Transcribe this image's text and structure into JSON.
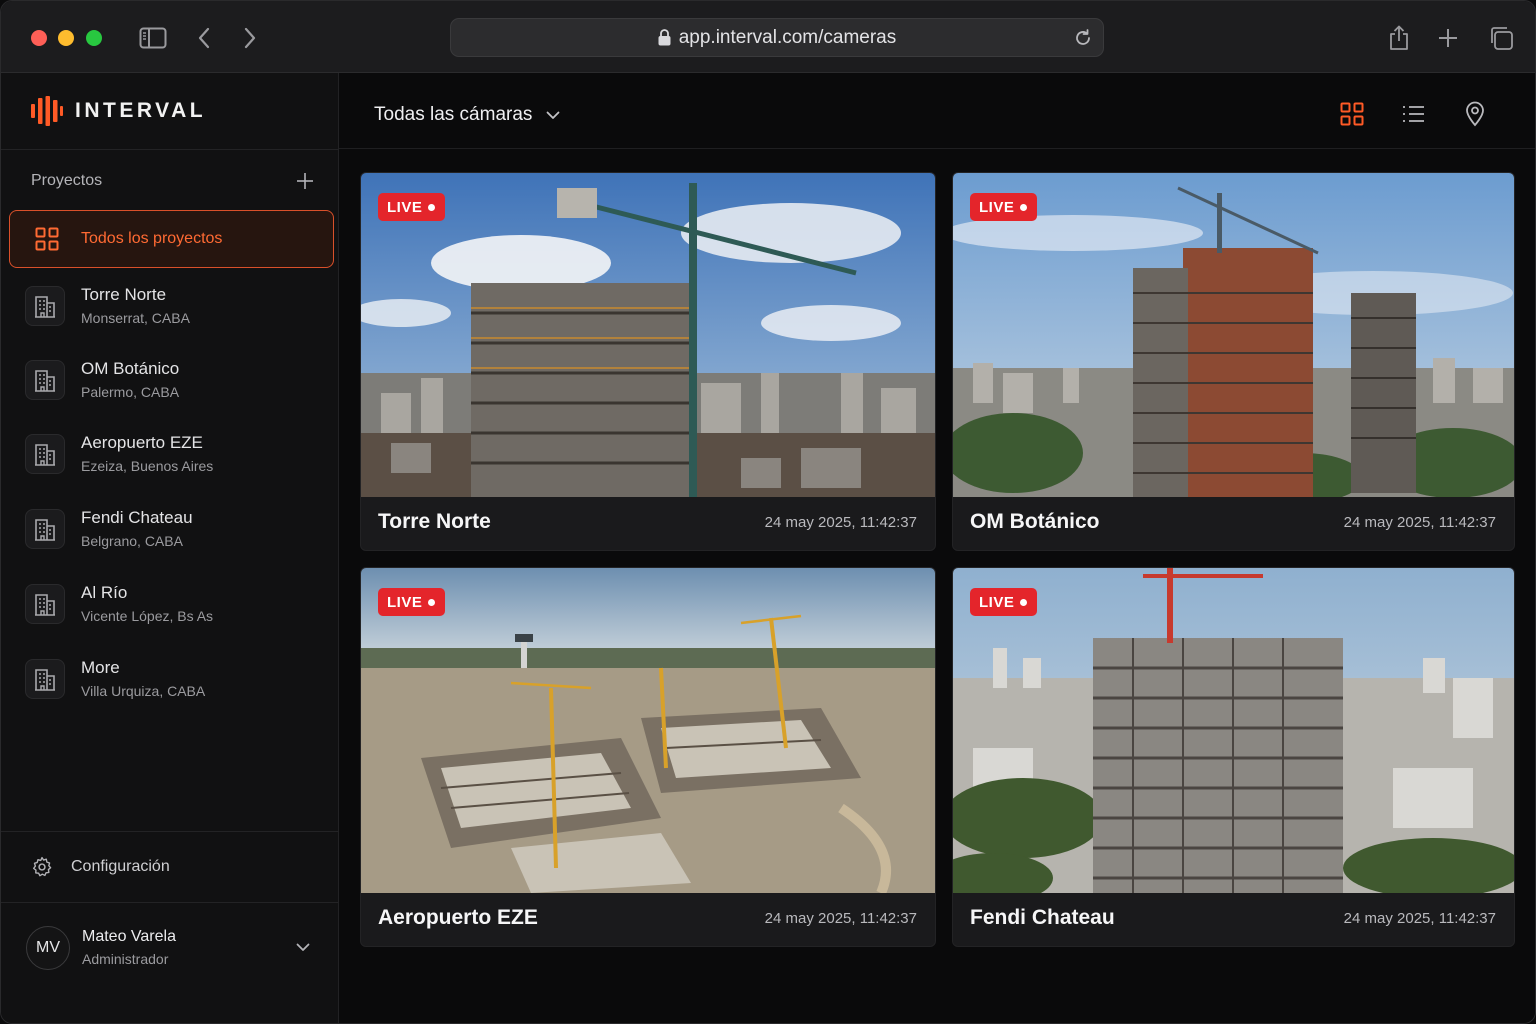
{
  "browser": {
    "url": "app.interval.com/cameras"
  },
  "brand": {
    "name": "INTERVAL",
    "accent": "#ff5a26"
  },
  "sidebar": {
    "projects_title": "Proyectos",
    "all_projects": "Todos los proyectos",
    "projects": [
      {
        "name": "Torre Norte",
        "location": "Monserrat, CABA"
      },
      {
        "name": "OM Botánico",
        "location": "Palermo, CABA"
      },
      {
        "name": "Aeropuerto EZE",
        "location": "Ezeiza, Buenos Aires"
      },
      {
        "name": "Fendi Chateau",
        "location": "Belgrano, CABA"
      },
      {
        "name": "Al Río",
        "location": "Vicente López, Bs As"
      },
      {
        "name": "More",
        "location": "Villa Urquiza, CABA"
      }
    ],
    "settings": "Configuración",
    "user": {
      "initials": "MV",
      "name": "Mateo Varela",
      "role": "Administrador"
    }
  },
  "main": {
    "filter": "Todas las cámaras",
    "cameras": [
      {
        "title": "Torre Norte",
        "timestamp": "24 may 2025, 11:42:37",
        "badge": "LIVE"
      },
      {
        "title": "OM Botánico",
        "timestamp": "24 may 2025, 11:42:37",
        "badge": "LIVE"
      },
      {
        "title": "Aeropuerto EZE",
        "timestamp": "24 may 2025, 11:42:37",
        "badge": "LIVE"
      },
      {
        "title": "Fendi Chateau",
        "timestamp": "24 may 2025, 11:42:37",
        "badge": "LIVE"
      }
    ]
  }
}
